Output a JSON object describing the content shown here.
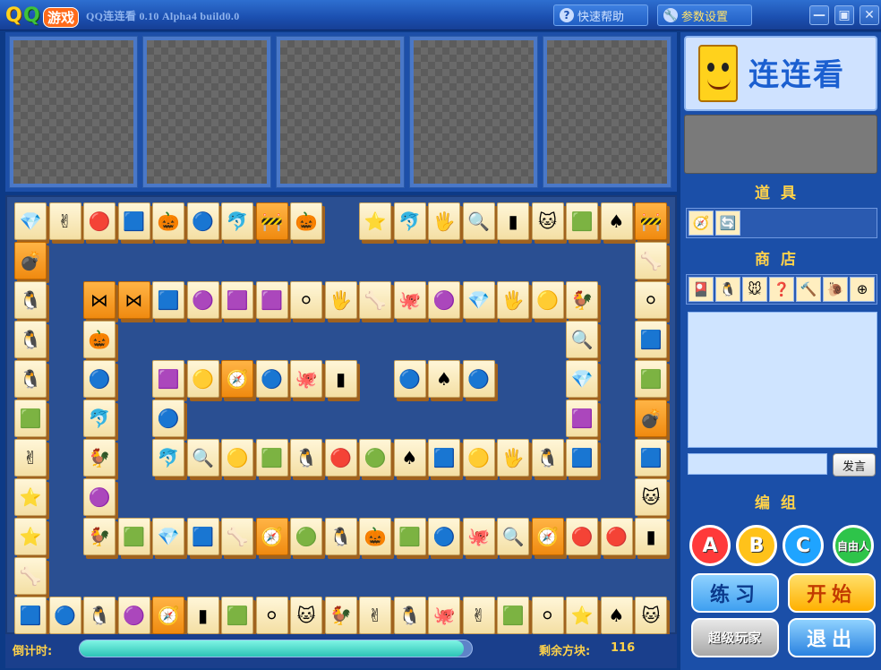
{
  "titlebar": {
    "logo_q": "Q",
    "logo_q2": "Q",
    "logo_game": "游戏",
    "app_title": "QQ连连看 0.10 Alpha4 build0.0",
    "help_label": "快速帮助",
    "settings_label": "参数设置",
    "min_glyph": "—",
    "max_glyph": "▣",
    "close_glyph": "✕"
  },
  "players": [
    "",
    "",
    "",
    "",
    ""
  ],
  "status": {
    "timer_label": "倒计时:",
    "timer_progress": 0.98,
    "remaining_label": "剩余方块:",
    "remaining_value": "116"
  },
  "right": {
    "brand_text": "连连看",
    "props_title": "道具",
    "shop_title": "商店",
    "group_title": "编组",
    "send_label": "发言",
    "group_buttons": [
      "A",
      "B",
      "C",
      "自由人"
    ],
    "practice_label": "练习",
    "start_label": "开始",
    "super_player_label": "超级玩家",
    "exit_label": "退出",
    "props_items": [
      "🧭",
      "🔄"
    ],
    "shop_items": [
      "🎴",
      "🐧",
      "🐭",
      "❓",
      "🔨",
      "🐌",
      "⊕"
    ]
  },
  "board": {
    "tiles": [
      [
        "💎",
        "r0c0"
      ],
      [
        "✌",
        "r0c1"
      ],
      [
        "🔴",
        "r0c2"
      ],
      [
        "🟦",
        "r0c3"
      ],
      [
        "🎃",
        "r0c4"
      ],
      [
        "🔵",
        "r0c5"
      ],
      [
        "🐬",
        "r0c6"
      ],
      [
        "🚧",
        "r0c7"
      ],
      [
        "🎃",
        "r0c8"
      ],
      [
        "⭐",
        "r0c10"
      ],
      [
        "🐬",
        "r0c11"
      ],
      [
        "🖐",
        "r0c12"
      ],
      [
        "🔍",
        "r0c13"
      ],
      [
        "▮",
        "r0c14"
      ],
      [
        "🐱",
        "r0c15"
      ],
      [
        "🟩",
        "r0c16"
      ],
      [
        "♠",
        "r0c17"
      ],
      [
        "🚧",
        "r0c18"
      ]
    ]
  }
}
